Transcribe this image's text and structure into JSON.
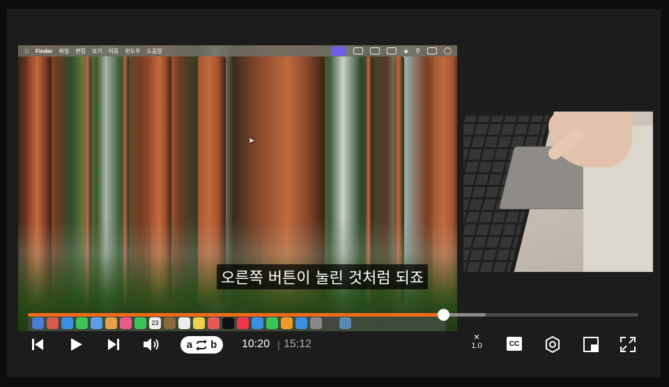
{
  "mac": {
    "menu": [
      "Finder",
      "파일",
      "편집",
      "보기",
      "이동",
      "윈도우",
      "도움말"
    ],
    "dock_date": "23"
  },
  "subtitle": "오른쪽 버튼이 눌린 것처럼 되죠",
  "player": {
    "current_time": "10:20",
    "separator": "|",
    "total_time": "15:12",
    "progress_fraction": 0.68,
    "buffered_fraction": 0.75,
    "ab_loop": {
      "a": "a",
      "b": "b"
    },
    "speed": {
      "x": "×",
      "value": "1.0"
    },
    "cc_label": "CC",
    "accent_color": "#f26a1b"
  },
  "icons": {
    "prev": "skip-back-icon",
    "play": "play-icon",
    "next": "skip-forward-icon",
    "volume": "volume-icon",
    "loop": "loop-icon",
    "settings": "gear-icon",
    "pip": "picture-in-picture-icon",
    "fullscreen": "fullscreen-icon"
  }
}
